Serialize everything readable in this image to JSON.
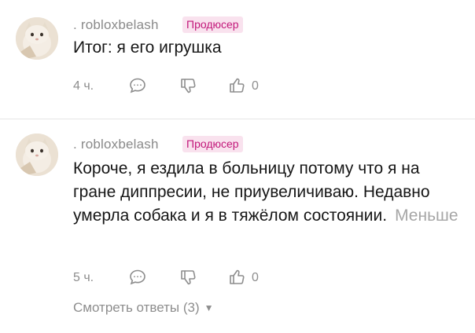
{
  "comments": [
    {
      "username": ". robloxbelash",
      "badge": "Продюсер",
      "text": "Итог: я его игрушка",
      "more_label": "",
      "time": "4 ч.",
      "like_count": "0"
    },
    {
      "username": ". robloxbelash",
      "badge": "Продюсер",
      "text": "Короче, я ездила в больницу потому что я на гране диппресии, не приувеличиваю. Недавно умерла собака и я в тяжёлом состоянии.",
      "more_label": "Меньше",
      "time": "5 ч.",
      "like_count": "0"
    }
  ],
  "view_replies": {
    "label": "Смотреть ответы (3)",
    "caret_icon": "caret-down-icon"
  },
  "icons": {
    "comment": "speech-bubble-icon",
    "dislike": "thumbs-down-icon",
    "like": "thumbs-up-icon"
  },
  "colors": {
    "badge_text": "#c2187a",
    "badge_bg": "#f9e2ee",
    "muted": "#8d8d8d"
  }
}
